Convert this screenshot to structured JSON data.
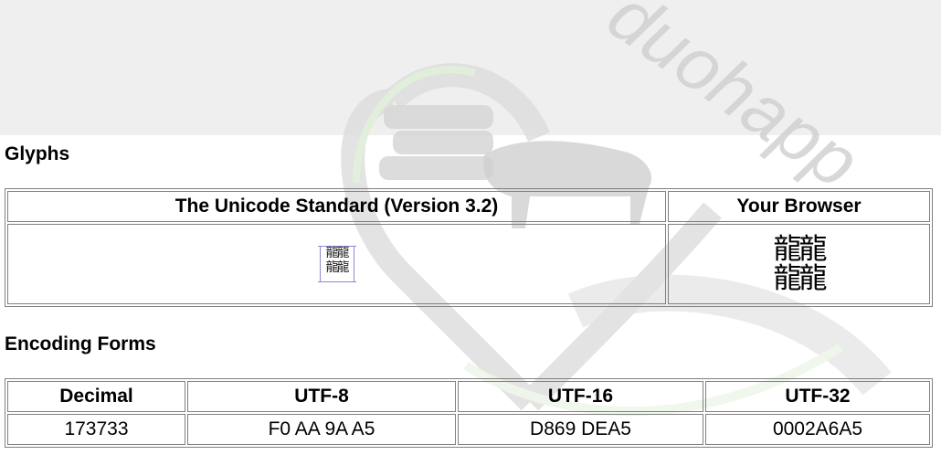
{
  "glyphs_section": {
    "heading": "Glyphs",
    "columns": [
      "The Unicode Standard (Version 3.2)",
      "Your Browser"
    ],
    "standard_glyph_rows": [
      "龍龍",
      "龍龍"
    ],
    "browser_glyph_rows": [
      "龍龍",
      "龍龍"
    ]
  },
  "encoding_section": {
    "heading": "Encoding Forms",
    "columns": [
      "Decimal",
      "UTF-8",
      "UTF-16",
      "UTF-32"
    ],
    "values": [
      "173733",
      "F0 AA 9A A5",
      "D869 DEA5",
      "0002A6A5"
    ]
  },
  "watermark": {
    "text": "duohapp",
    "color": "#c8c8c8"
  }
}
